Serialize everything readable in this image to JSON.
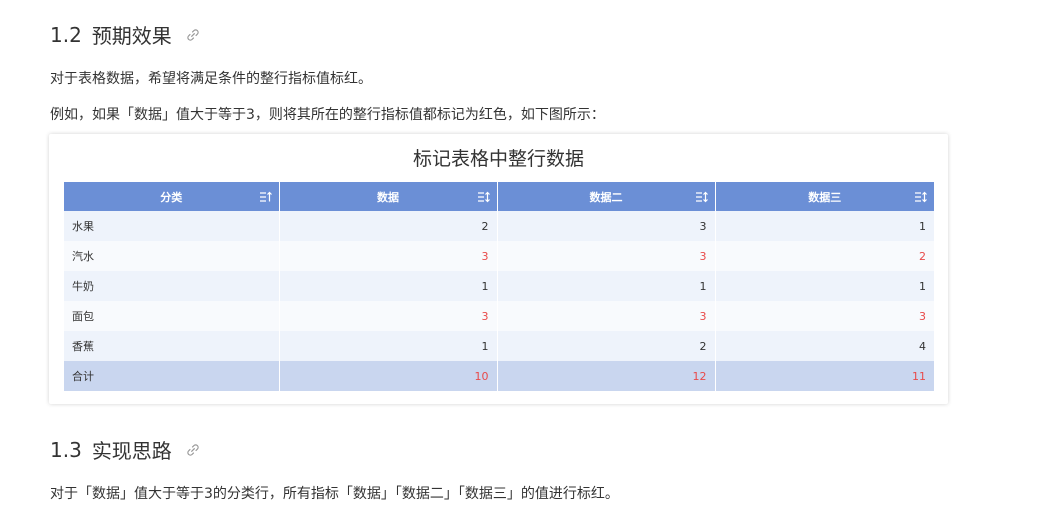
{
  "section_12": {
    "number": "1.2",
    "title": "预期效果",
    "para1": "对于表格数据，希望将满足条件的整行指标值标红。",
    "para2": "例如，如果「数据」值大于等于3，则将其所在的整行指标值都标记为红色，如下图所示："
  },
  "table": {
    "title": "标记表格中整行数据",
    "headers": [
      "分类",
      "数据",
      "数据二",
      "数据三"
    ],
    "rows": [
      {
        "cat": "水果",
        "v1": "2",
        "v2": "3",
        "v3": "1"
      },
      {
        "cat": "汽水",
        "v1": "3",
        "v2": "3",
        "v3": "2"
      },
      {
        "cat": "牛奶",
        "v1": "1",
        "v2": "1",
        "v3": "1"
      },
      {
        "cat": "面包",
        "v1": "3",
        "v2": "3",
        "v3": "3"
      },
      {
        "cat": "香蕉",
        "v1": "1",
        "v2": "2",
        "v3": "4"
      }
    ],
    "total": {
      "cat": "合计",
      "v1": "10",
      "v2": "12",
      "v3": "11"
    },
    "colors": {
      "header": "#6b8fd6",
      "highlight": "#e84a4a",
      "total_row": "#c9d6ef"
    }
  },
  "section_13": {
    "number": "1.3",
    "title": "实现思路",
    "para1": "对于「数据」值大于等于3的分类行，所有指标「数据」「数据二」「数据三」的值进行标红。"
  },
  "icons": {
    "heading_anchor": "link-icon",
    "sort": "sort-icon"
  }
}
